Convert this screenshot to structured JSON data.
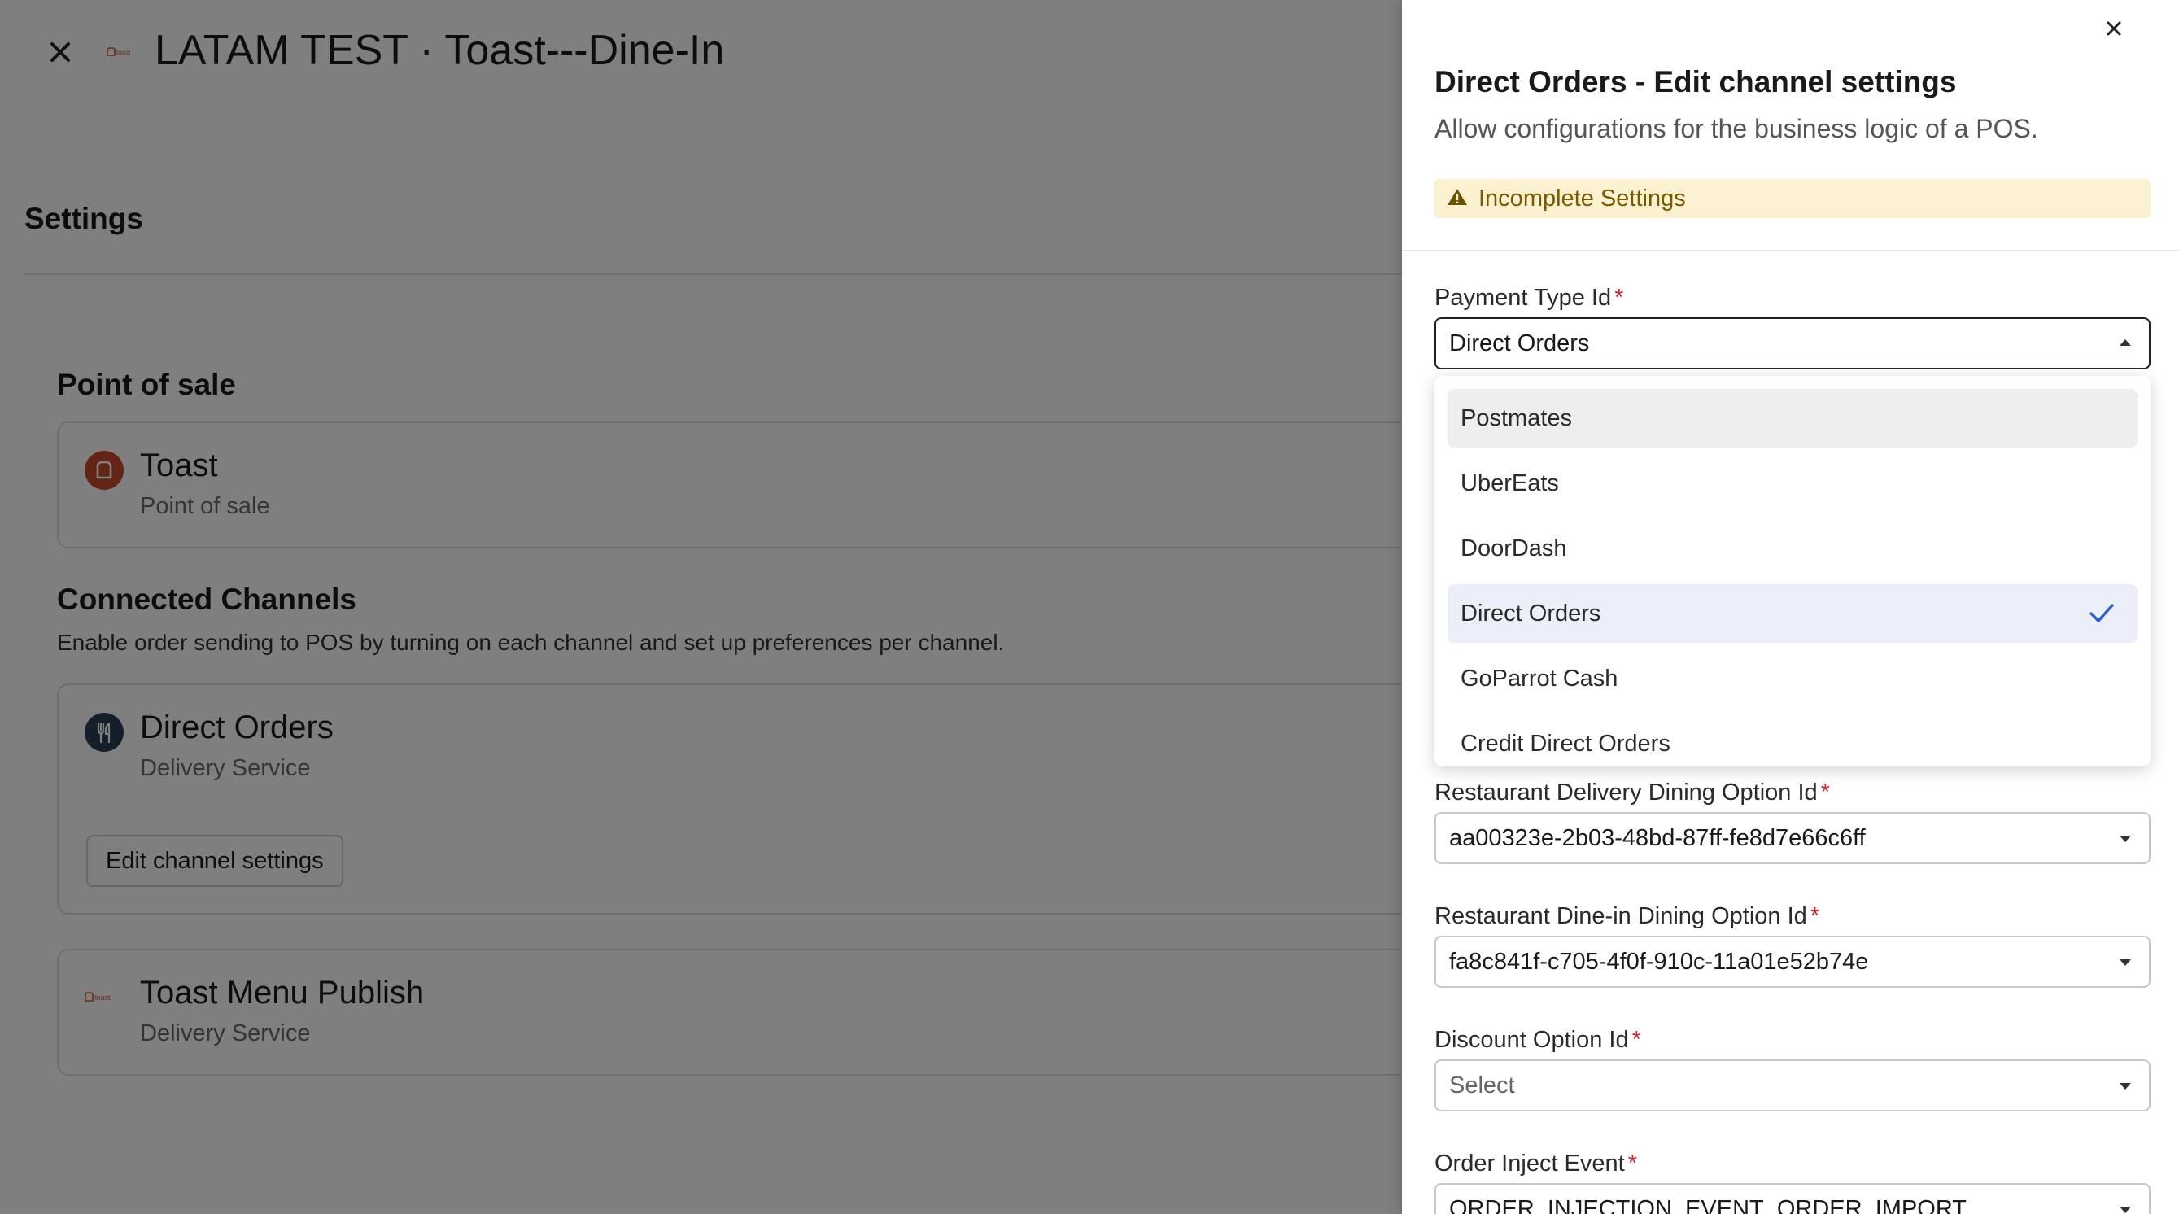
{
  "header": {
    "close_icon": "close-icon",
    "logo_text": "toast",
    "title": "LATAM TEST · Toast---Dine-In"
  },
  "settings": {
    "title": "Settings"
  },
  "point_of_sale": {
    "title": "Point of sale",
    "card": {
      "name": "Toast",
      "type": "Point of sale",
      "icon": "toast-icon",
      "icon_color": "#c94a2c"
    }
  },
  "connected_channels": {
    "title": "Connected Channels",
    "description": "Enable order sending to POS by turning on each channel and set up preferences per channel.",
    "channels": [
      {
        "name": "Direct Orders",
        "type": "Delivery Service",
        "icon": "fork-knife-icon",
        "button": "Edit channel settings"
      },
      {
        "name": "Toast Menu Publish",
        "type": "Delivery Service",
        "icon": "toast-logo-icon",
        "logo_text": "toast"
      }
    ]
  },
  "drawer": {
    "title": "Direct Orders - Edit channel settings",
    "subtitle": "Allow configurations for the business logic of a POS.",
    "warning": "Incomplete Settings",
    "warning_color": "#fbf1d0",
    "required_marker": "*",
    "fields": {
      "payment_type": {
        "label": "Payment Type Id",
        "value": "Direct Orders"
      },
      "delivery_dining": {
        "label": "Restaurant Delivery Dining Option Id",
        "value": "aa00323e-2b03-48bd-87ff-fe8d7e66c6ff"
      },
      "dinein_dining": {
        "label": "Restaurant Dine-in Dining Option Id",
        "value": "fa8c841f-c705-4f0f-910c-11a01e52b74e"
      },
      "discount": {
        "label": "Discount Option Id",
        "placeholder": "Select"
      },
      "order_inject": {
        "label": "Order Inject Event",
        "value": "ORDER_INJECTION_EVENT_ORDER_IMPORT"
      }
    },
    "dropdown_options": [
      {
        "label": "Postmates"
      },
      {
        "label": "UberEats"
      },
      {
        "label": "DoorDash"
      },
      {
        "label": "Direct Orders",
        "selected": true
      },
      {
        "label": "GoParrot Cash"
      },
      {
        "label": "Credit Direct Orders"
      }
    ],
    "accent_color": "#2f5fc4"
  }
}
